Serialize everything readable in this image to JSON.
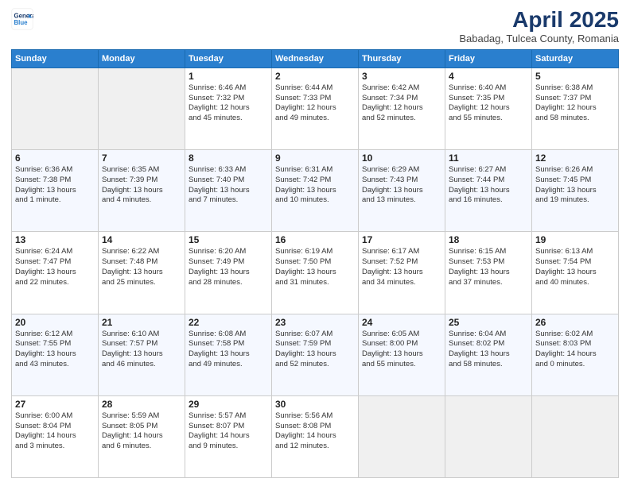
{
  "header": {
    "logo_line1": "General",
    "logo_line2": "Blue",
    "title": "April 2025",
    "subtitle": "Babadag, Tulcea County, Romania"
  },
  "columns": [
    "Sunday",
    "Monday",
    "Tuesday",
    "Wednesday",
    "Thursday",
    "Friday",
    "Saturday"
  ],
  "weeks": [
    [
      {
        "day": "",
        "lines": []
      },
      {
        "day": "",
        "lines": []
      },
      {
        "day": "1",
        "lines": [
          "Sunrise: 6:46 AM",
          "Sunset: 7:32 PM",
          "Daylight: 12 hours",
          "and 45 minutes."
        ]
      },
      {
        "day": "2",
        "lines": [
          "Sunrise: 6:44 AM",
          "Sunset: 7:33 PM",
          "Daylight: 12 hours",
          "and 49 minutes."
        ]
      },
      {
        "day": "3",
        "lines": [
          "Sunrise: 6:42 AM",
          "Sunset: 7:34 PM",
          "Daylight: 12 hours",
          "and 52 minutes."
        ]
      },
      {
        "day": "4",
        "lines": [
          "Sunrise: 6:40 AM",
          "Sunset: 7:35 PM",
          "Daylight: 12 hours",
          "and 55 minutes."
        ]
      },
      {
        "day": "5",
        "lines": [
          "Sunrise: 6:38 AM",
          "Sunset: 7:37 PM",
          "Daylight: 12 hours",
          "and 58 minutes."
        ]
      }
    ],
    [
      {
        "day": "6",
        "lines": [
          "Sunrise: 6:36 AM",
          "Sunset: 7:38 PM",
          "Daylight: 13 hours",
          "and 1 minute."
        ]
      },
      {
        "day": "7",
        "lines": [
          "Sunrise: 6:35 AM",
          "Sunset: 7:39 PM",
          "Daylight: 13 hours",
          "and 4 minutes."
        ]
      },
      {
        "day": "8",
        "lines": [
          "Sunrise: 6:33 AM",
          "Sunset: 7:40 PM",
          "Daylight: 13 hours",
          "and 7 minutes."
        ]
      },
      {
        "day": "9",
        "lines": [
          "Sunrise: 6:31 AM",
          "Sunset: 7:42 PM",
          "Daylight: 13 hours",
          "and 10 minutes."
        ]
      },
      {
        "day": "10",
        "lines": [
          "Sunrise: 6:29 AM",
          "Sunset: 7:43 PM",
          "Daylight: 13 hours",
          "and 13 minutes."
        ]
      },
      {
        "day": "11",
        "lines": [
          "Sunrise: 6:27 AM",
          "Sunset: 7:44 PM",
          "Daylight: 13 hours",
          "and 16 minutes."
        ]
      },
      {
        "day": "12",
        "lines": [
          "Sunrise: 6:26 AM",
          "Sunset: 7:45 PM",
          "Daylight: 13 hours",
          "and 19 minutes."
        ]
      }
    ],
    [
      {
        "day": "13",
        "lines": [
          "Sunrise: 6:24 AM",
          "Sunset: 7:47 PM",
          "Daylight: 13 hours",
          "and 22 minutes."
        ]
      },
      {
        "day": "14",
        "lines": [
          "Sunrise: 6:22 AM",
          "Sunset: 7:48 PM",
          "Daylight: 13 hours",
          "and 25 minutes."
        ]
      },
      {
        "day": "15",
        "lines": [
          "Sunrise: 6:20 AM",
          "Sunset: 7:49 PM",
          "Daylight: 13 hours",
          "and 28 minutes."
        ]
      },
      {
        "day": "16",
        "lines": [
          "Sunrise: 6:19 AM",
          "Sunset: 7:50 PM",
          "Daylight: 13 hours",
          "and 31 minutes."
        ]
      },
      {
        "day": "17",
        "lines": [
          "Sunrise: 6:17 AM",
          "Sunset: 7:52 PM",
          "Daylight: 13 hours",
          "and 34 minutes."
        ]
      },
      {
        "day": "18",
        "lines": [
          "Sunrise: 6:15 AM",
          "Sunset: 7:53 PM",
          "Daylight: 13 hours",
          "and 37 minutes."
        ]
      },
      {
        "day": "19",
        "lines": [
          "Sunrise: 6:13 AM",
          "Sunset: 7:54 PM",
          "Daylight: 13 hours",
          "and 40 minutes."
        ]
      }
    ],
    [
      {
        "day": "20",
        "lines": [
          "Sunrise: 6:12 AM",
          "Sunset: 7:55 PM",
          "Daylight: 13 hours",
          "and 43 minutes."
        ]
      },
      {
        "day": "21",
        "lines": [
          "Sunrise: 6:10 AM",
          "Sunset: 7:57 PM",
          "Daylight: 13 hours",
          "and 46 minutes."
        ]
      },
      {
        "day": "22",
        "lines": [
          "Sunrise: 6:08 AM",
          "Sunset: 7:58 PM",
          "Daylight: 13 hours",
          "and 49 minutes."
        ]
      },
      {
        "day": "23",
        "lines": [
          "Sunrise: 6:07 AM",
          "Sunset: 7:59 PM",
          "Daylight: 13 hours",
          "and 52 minutes."
        ]
      },
      {
        "day": "24",
        "lines": [
          "Sunrise: 6:05 AM",
          "Sunset: 8:00 PM",
          "Daylight: 13 hours",
          "and 55 minutes."
        ]
      },
      {
        "day": "25",
        "lines": [
          "Sunrise: 6:04 AM",
          "Sunset: 8:02 PM",
          "Daylight: 13 hours",
          "and 58 minutes."
        ]
      },
      {
        "day": "26",
        "lines": [
          "Sunrise: 6:02 AM",
          "Sunset: 8:03 PM",
          "Daylight: 14 hours",
          "and 0 minutes."
        ]
      }
    ],
    [
      {
        "day": "27",
        "lines": [
          "Sunrise: 6:00 AM",
          "Sunset: 8:04 PM",
          "Daylight: 14 hours",
          "and 3 minutes."
        ]
      },
      {
        "day": "28",
        "lines": [
          "Sunrise: 5:59 AM",
          "Sunset: 8:05 PM",
          "Daylight: 14 hours",
          "and 6 minutes."
        ]
      },
      {
        "day": "29",
        "lines": [
          "Sunrise: 5:57 AM",
          "Sunset: 8:07 PM",
          "Daylight: 14 hours",
          "and 9 minutes."
        ]
      },
      {
        "day": "30",
        "lines": [
          "Sunrise: 5:56 AM",
          "Sunset: 8:08 PM",
          "Daylight: 14 hours",
          "and 12 minutes."
        ]
      },
      {
        "day": "",
        "lines": []
      },
      {
        "day": "",
        "lines": []
      },
      {
        "day": "",
        "lines": []
      }
    ]
  ]
}
